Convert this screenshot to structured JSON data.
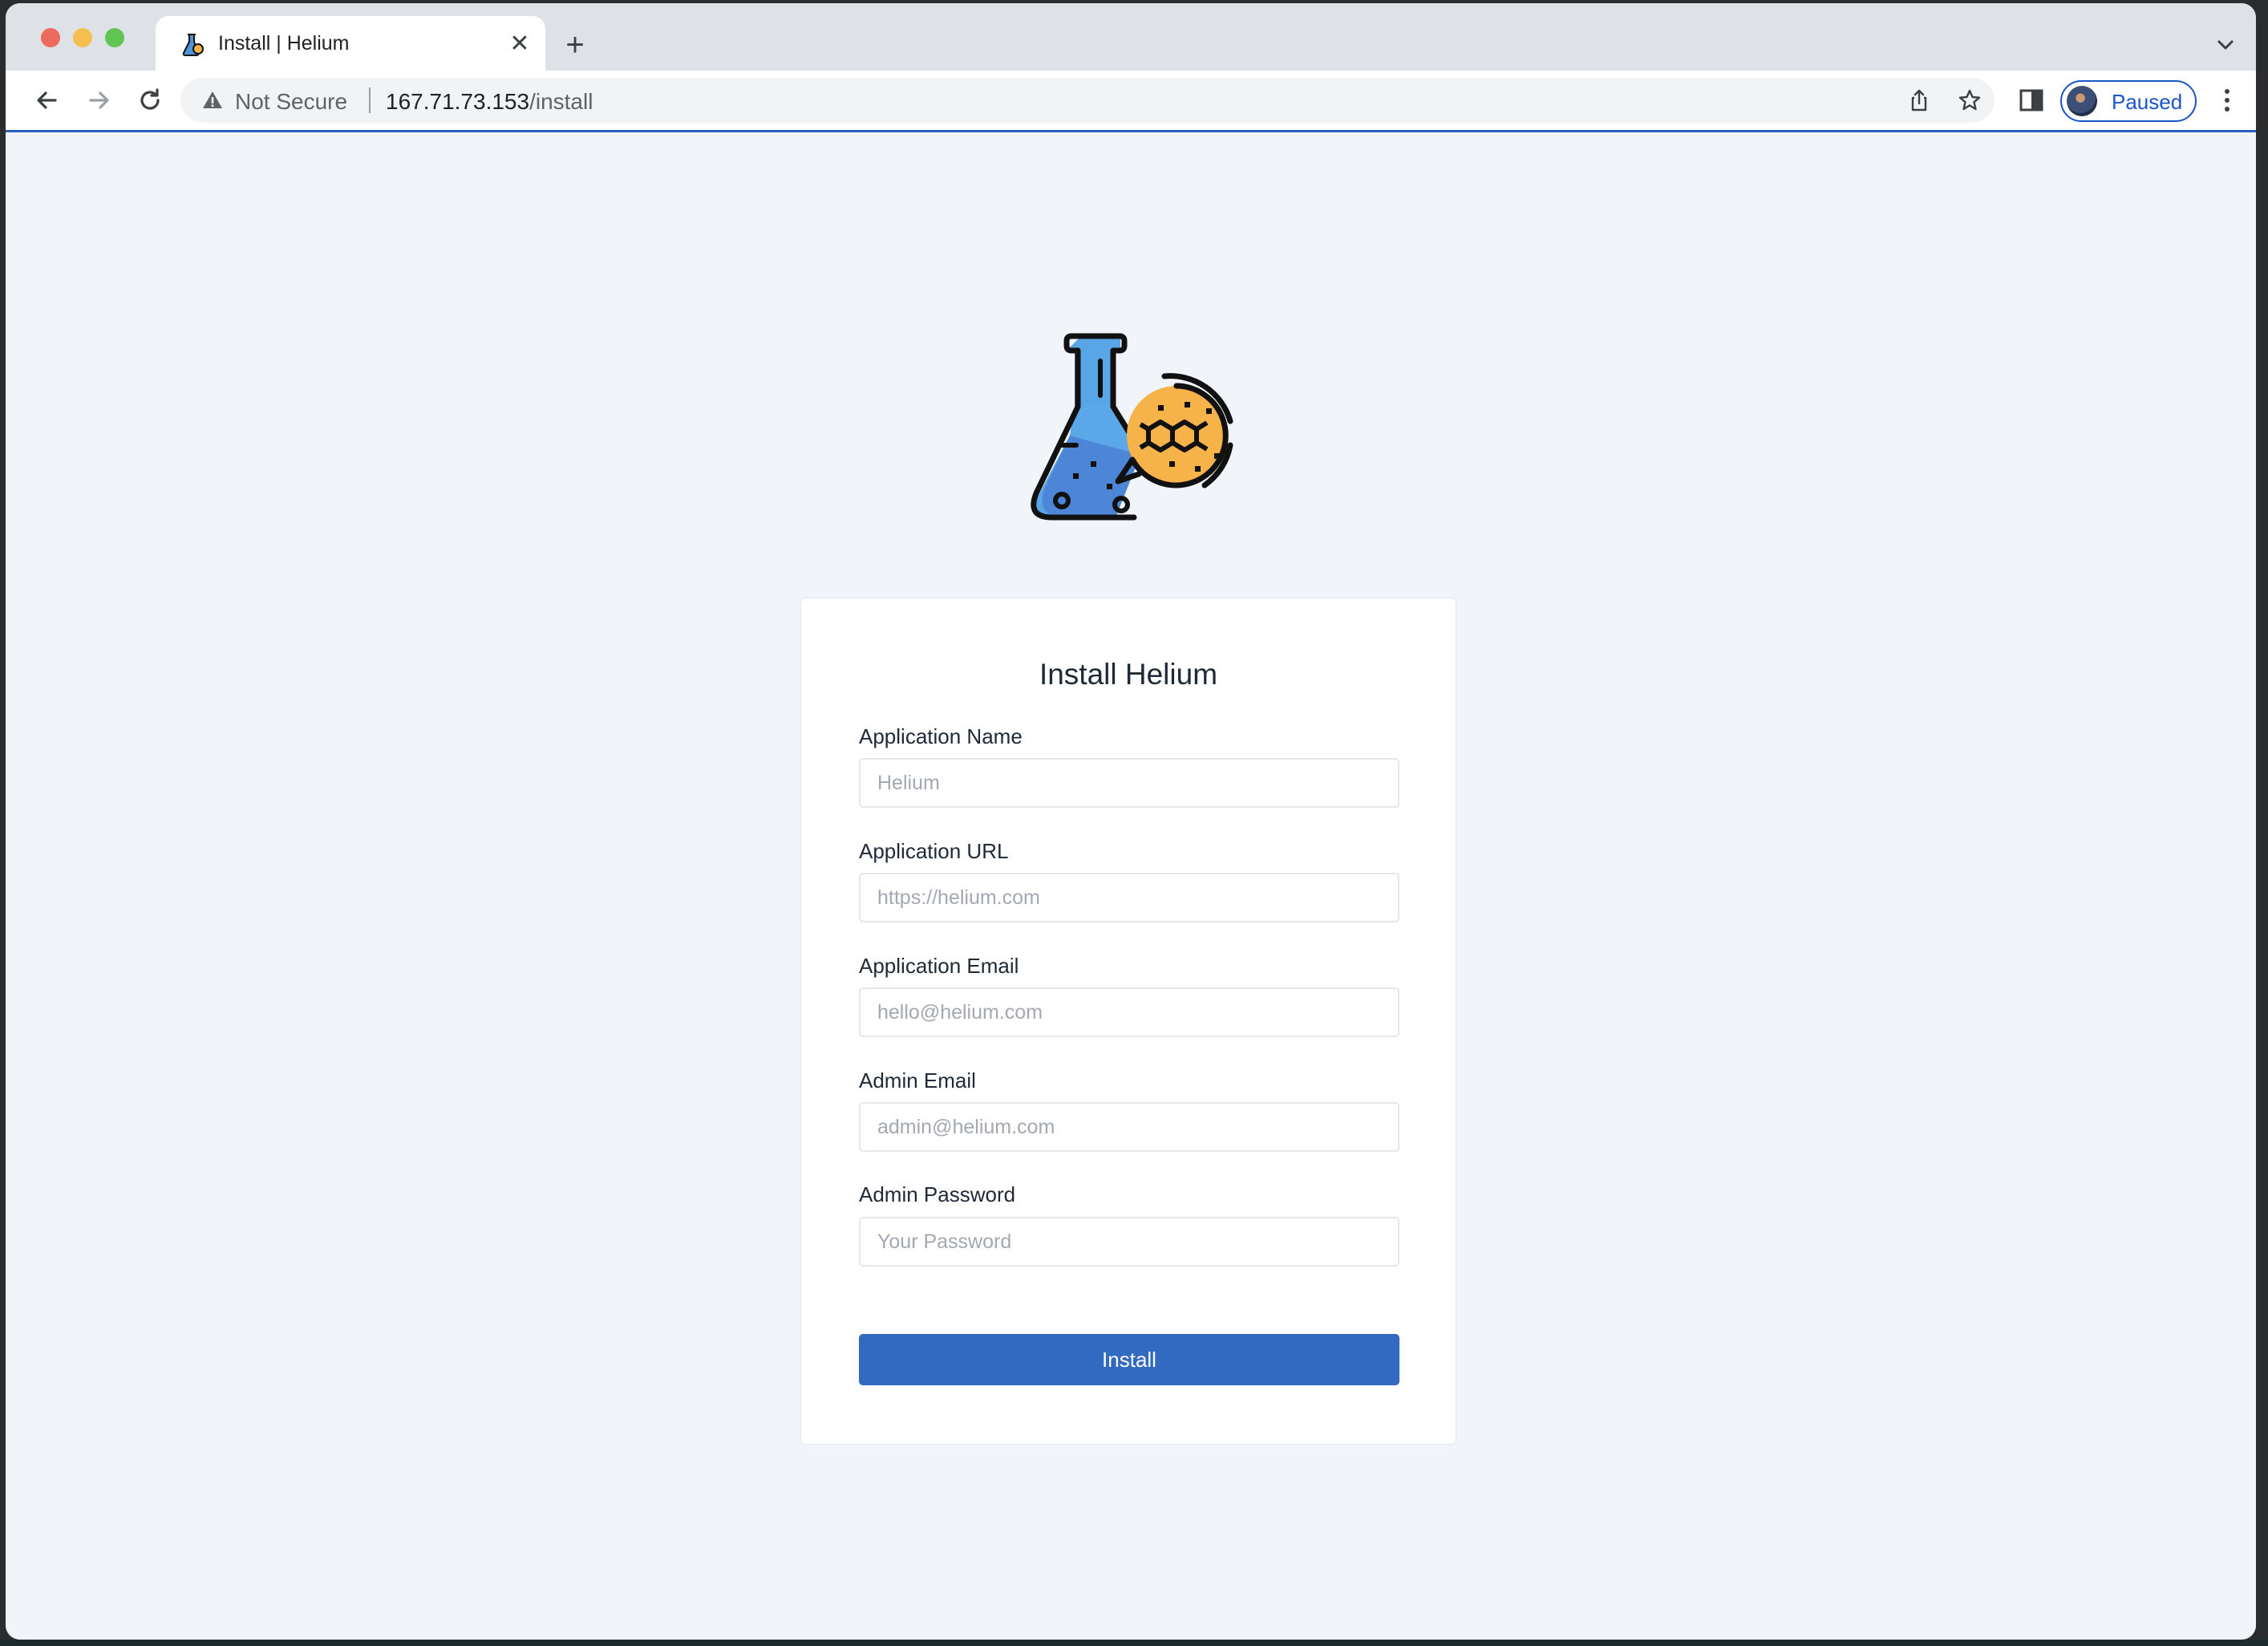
{
  "browser": {
    "tab": {
      "title": "Install | Helium",
      "close_glyph": "✕",
      "favicon": "flask-icon"
    },
    "new_tab_glyph": "+",
    "toolbar": {
      "back": "back-arrow-icon",
      "forward": "forward-arrow-icon",
      "reload": "reload-icon"
    },
    "omnibox": {
      "security_label": "Not Secure",
      "url_host": "167.71.73.153",
      "url_path": "/install"
    },
    "profile": {
      "status": "Paused"
    }
  },
  "page": {
    "logo": "flask-molecule-icon",
    "card": {
      "title": "Install Helium",
      "fields": [
        {
          "label": "Application Name",
          "placeholder": "Helium",
          "value": ""
        },
        {
          "label": "Application URL",
          "placeholder": "https://helium.com",
          "value": ""
        },
        {
          "label": "Application Email",
          "placeholder": "hello@helium.com",
          "value": ""
        },
        {
          "label": "Admin Email",
          "placeholder": "admin@helium.com",
          "value": ""
        },
        {
          "label": "Admin Password",
          "placeholder": "Your Password",
          "value": ""
        }
      ],
      "submit_label": "Install"
    }
  },
  "colors": {
    "accent": "#316ac0",
    "page_background": "#f1f4f8",
    "flask_blue": "#4f93dc",
    "molecule_orange": "#f5b349"
  }
}
